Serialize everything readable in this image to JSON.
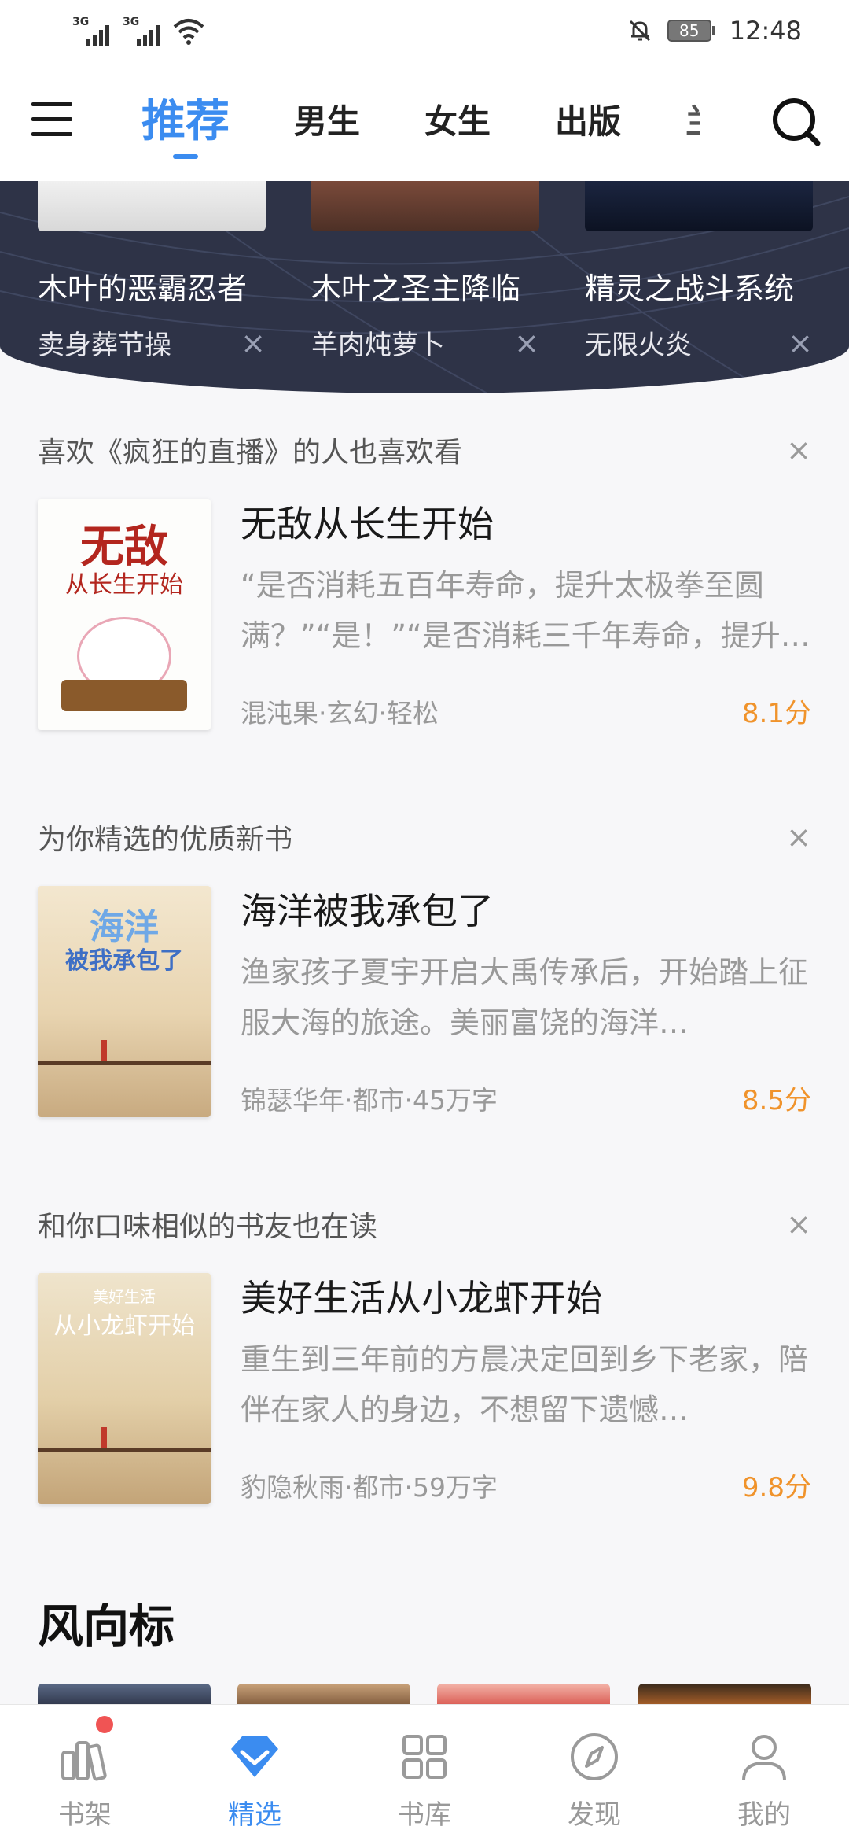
{
  "status_bar": {
    "signal1_label": "3G",
    "signal2_label": "3G",
    "battery": "85",
    "time": "12:48",
    "icons": [
      "signal-icon",
      "wifi-icon",
      "bell-muted-icon",
      "battery-icon"
    ]
  },
  "top_nav": {
    "tabs": [
      {
        "label": "推荐",
        "active": true
      },
      {
        "label": "男生"
      },
      {
        "label": "女生"
      },
      {
        "label": "出版"
      },
      {
        "label": "兰"
      }
    ]
  },
  "banner": {
    "books": [
      {
        "title": "木叶的恶霸忍者",
        "author": "卖身葬节操"
      },
      {
        "title": "木叶之圣主降临",
        "author": "羊肉炖萝卜"
      },
      {
        "title": "精灵之战斗系统",
        "author": "无限火炎"
      }
    ],
    "close": "×"
  },
  "sections": [
    {
      "title": "喜欢《疯狂的直播》的人也喜欢看",
      "book": {
        "title": "无敌从长生开始",
        "desc": "“是否消耗五百年寿命，提升太极拳至圆满？”“是！”“是否消耗三千年寿命，提升…",
        "meta": "混沌果·玄幻·轻松",
        "score": "8.1分",
        "cover_text": "无敌",
        "cover_text2": "从长生开始"
      }
    },
    {
      "title": "为你精选的优质新书",
      "book": {
        "title": "海洋被我承包了",
        "desc": "渔家孩子夏宇开启大禹传承后，开始踏上征服大海的旅途。美丽富饶的海洋…",
        "meta": "锦瑟华年·都市·45万字",
        "score": "8.5分",
        "cover_text": "海洋",
        "cover_text2": "被我承包了"
      }
    },
    {
      "title": "和你口味相似的书友也在读",
      "book": {
        "title": "美好生活从小龙虾开始",
        "desc": "重生到三年前的方晨决定回到乡下老家，陪伴在家人的身边，不想留下遗憾…",
        "meta": "豹隐秋雨·都市·59万字",
        "score": "9.8分",
        "cover_text": "美好生活",
        "cover_text2": "从小龙虾开始"
      }
    }
  ],
  "wind": {
    "title": "风向标"
  },
  "bottom_bar": {
    "items": [
      {
        "label": "书架",
        "icon": "bookshelf-icon",
        "badge": true
      },
      {
        "label": "精选",
        "icon": "diamond-icon",
        "active": true
      },
      {
        "label": "书库",
        "icon": "grid-icon"
      },
      {
        "label": "发现",
        "icon": "compass-icon"
      },
      {
        "label": "我的",
        "icon": "profile-icon"
      }
    ]
  },
  "colors": {
    "accent": "#3b8cf0",
    "score": "#f0932b",
    "banner": "#2e3347",
    "badge": "#f05454"
  }
}
